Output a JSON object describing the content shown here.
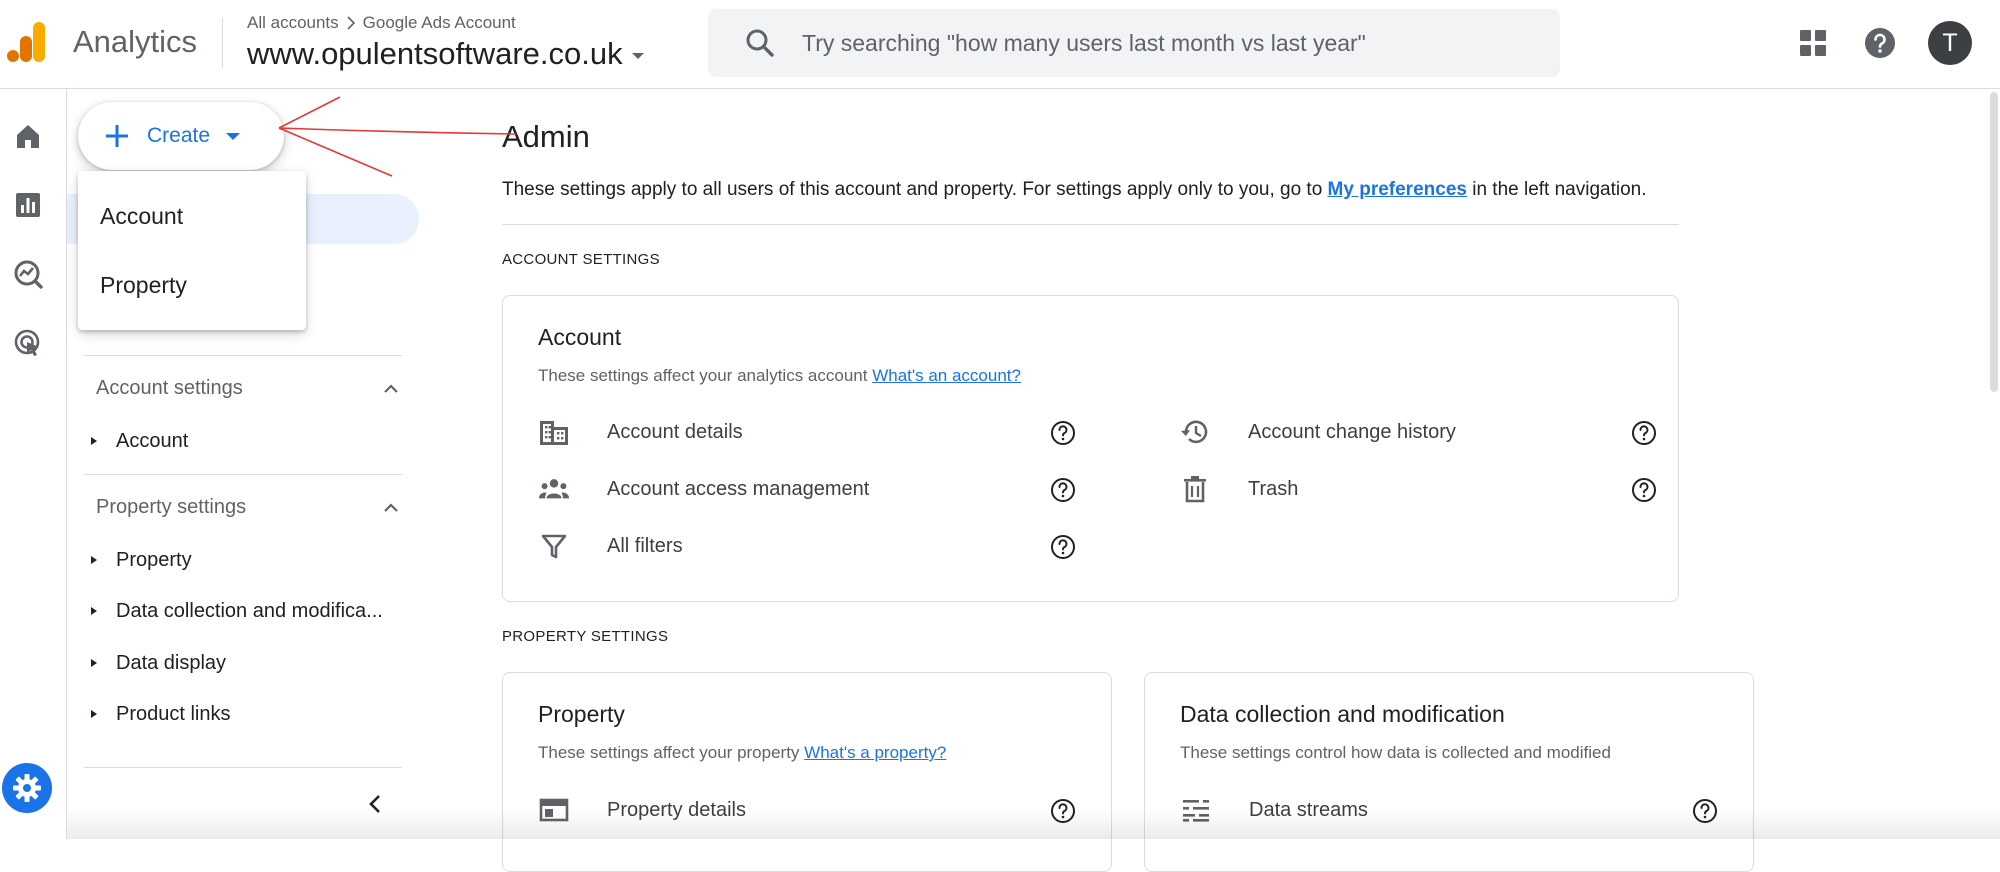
{
  "header": {
    "app_title": "Analytics",
    "breadcrumb": [
      "All accounts",
      "Google Ads Account"
    ],
    "property_name": "www.opulentsoftware.co.uk",
    "search_placeholder": "Try searching \"how many users last month vs last year\"",
    "avatar_initial": "T"
  },
  "rail": {
    "icons": [
      "home-icon",
      "reports-icon",
      "explore-icon",
      "advertising-icon",
      "admin-settings-icon"
    ]
  },
  "sidenav": {
    "create_label": "Create",
    "account_settings_label": "Account settings",
    "account_items": [
      "Account"
    ],
    "property_settings_label": "Property settings",
    "property_items": [
      "Property",
      "Data collection and modifica...",
      "Data display",
      "Product links"
    ]
  },
  "create_menu": {
    "items": [
      "Account",
      "Property"
    ]
  },
  "main": {
    "title": "Admin",
    "description_before": "These settings apply to all users of this account and property. For settings apply only to you, go to ",
    "description_link": "My preferences",
    "description_after": " in the left navigation.",
    "account_section_heading": "ACCOUNT SETTINGS",
    "property_section_heading": "PROPERTY SETTINGS",
    "account_card": {
      "title": "Account",
      "subtitle": "These settings affect your analytics account ",
      "subtitle_link": "What's an account?",
      "left_rows": [
        "Account details",
        "Account access management",
        "All filters"
      ],
      "right_rows": [
        "Account change history",
        "Trash"
      ]
    },
    "property_card": {
      "title": "Property",
      "subtitle": "These settings affect your property ",
      "subtitle_link": "What's a property?",
      "rows": [
        "Property details"
      ]
    },
    "data_collection_card": {
      "title": "Data collection and modification",
      "subtitle": "These settings control how data is collected and modified",
      "rows": [
        "Data streams"
      ]
    }
  },
  "colors": {
    "accent": "#1a73e8",
    "logo_orange": "#f9ab00",
    "logo_dark_orange": "#e37400",
    "annotation_red": "#e53935",
    "nav_highlight": "#e8f0fe"
  }
}
